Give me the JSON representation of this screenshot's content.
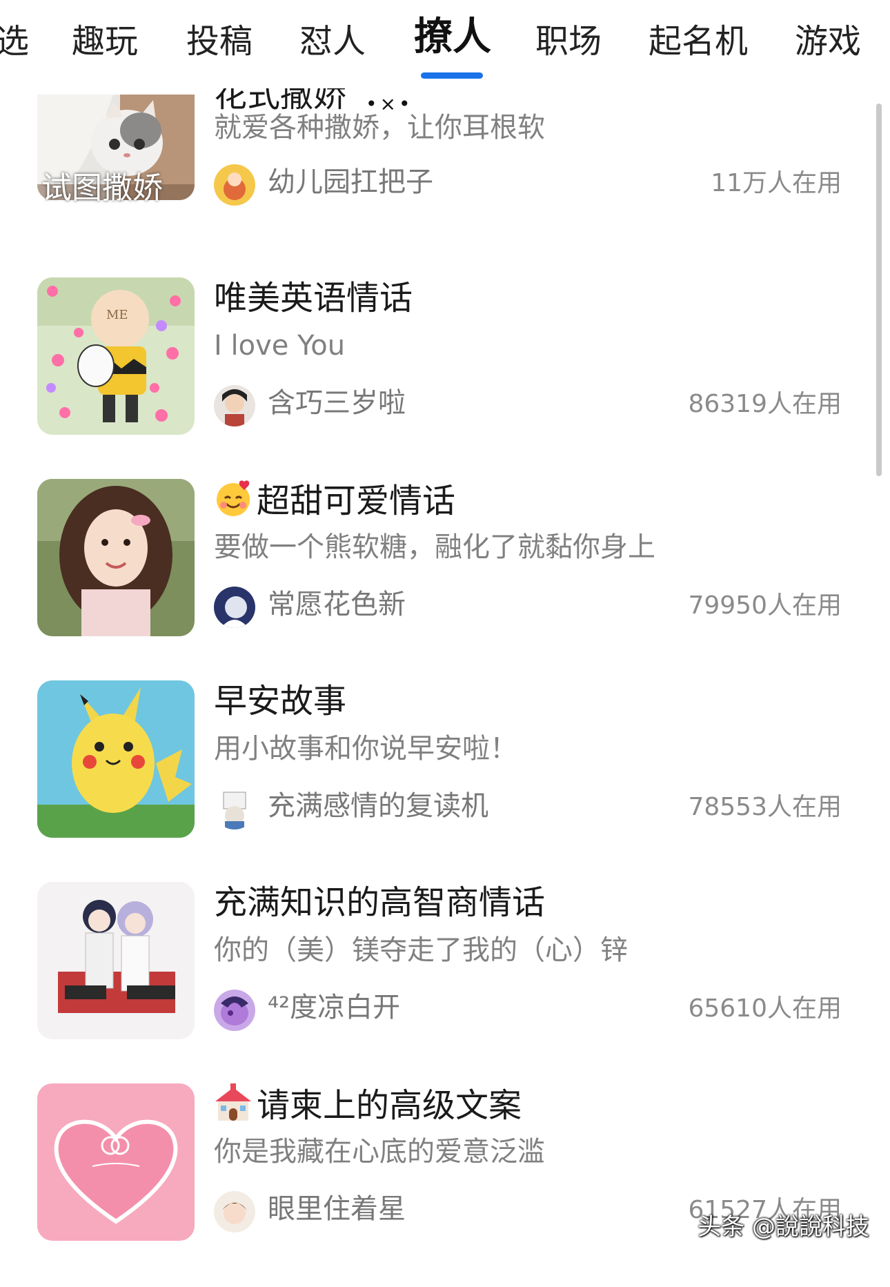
{
  "tabs": [
    {
      "label": "选",
      "active": false
    },
    {
      "label": "趣玩",
      "active": false
    },
    {
      "label": "投稿",
      "active": false
    },
    {
      "label": "怼人",
      "active": false
    },
    {
      "label": "撩人",
      "active": true
    },
    {
      "label": "职场",
      "active": false
    },
    {
      "label": "起名机",
      "active": false
    },
    {
      "label": "游戏",
      "active": false
    }
  ],
  "accent_color": "#1a73e8",
  "items": [
    {
      "title": "花式撒娇",
      "title_deco": "•×•",
      "subtitle": "就爱各种撒娇，让你耳根软",
      "author": "幼儿园扛把子",
      "usage": "11万人在用",
      "thumb_caption": "试图撒娇",
      "thumb_icon": "cat-thumbnail"
    },
    {
      "title": "唯美英语情话",
      "subtitle": "I love You",
      "author": "含巧三岁啦",
      "usage": "86319人在用",
      "thumb_icon": "cartoon-hearts-thumbnail"
    },
    {
      "title": "超甜可爱情话",
      "title_emoji": "smiling-face-with-hearts-icon",
      "subtitle": "要做一个熊软糖，融化了就黏你身上",
      "author": "常愿花色新",
      "usage": "79950人在用",
      "thumb_icon": "girl-portrait-thumbnail"
    },
    {
      "title": "早安故事",
      "subtitle": "用小故事和你说早安啦！",
      "author": "充满感情的复读机",
      "usage": "78553人在用",
      "thumb_icon": "pikachu-thumbnail"
    },
    {
      "title": "充满知识的高智商情话",
      "subtitle": "你的（美）镁夺走了我的（心）锌",
      "author": "⁴²度凉白开",
      "usage": "65610人在用",
      "thumb_icon": "anime-couple-thumbnail"
    },
    {
      "title": "请柬上的高级文案",
      "title_emoji": "wedding-chapel-icon",
      "subtitle": "你是我藏在心底的爱意泛滥",
      "author": "眼里住着星",
      "usage": "61527人在用",
      "thumb_icon": "wedding-card-thumbnail"
    }
  ],
  "watermark": "头条 @說說科技"
}
